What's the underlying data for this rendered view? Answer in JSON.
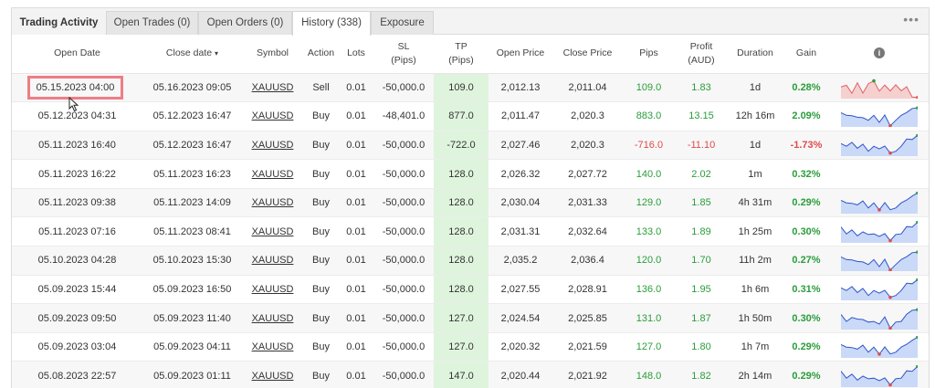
{
  "tabs": [
    {
      "label": "Trading Activity",
      "active": false
    },
    {
      "label": "Open Trades (0)",
      "active": false
    },
    {
      "label": "Open Orders (0)",
      "active": false
    },
    {
      "label": "History (338)",
      "active": true
    },
    {
      "label": "Exposure",
      "active": false
    }
  ],
  "menu_icon": "more-dots-icon",
  "columns": {
    "open_date": "Open Date",
    "close_date": "Close date",
    "close_date_sort": "▾",
    "symbol": "Symbol",
    "action": "Action",
    "lots": "Lots",
    "sl_1": "SL",
    "sl_2": "(Pips)",
    "tp_1": "TP",
    "tp_2": "(Pips)",
    "open_price": "Open Price",
    "close_price": "Close Price",
    "pips": "Pips",
    "profit_1": "Profit",
    "profit_2": "(AUD)",
    "duration": "Duration",
    "gain": "Gain",
    "info": "i"
  },
  "colors": {
    "positive": "#2a9d3a",
    "negative": "#e04b4b",
    "tp_highlight": "#dff4dd",
    "spark_fill": "#c9d9f7",
    "spark_line": "#2f55c9",
    "spark_fill_loss": "#f6cfcf",
    "spark_line_loss": "#e06060"
  },
  "rows": [
    {
      "open": "05.15.2023 04:00",
      "close": "05.16.2023 09:05",
      "symbol": "XAUUSD",
      "action": "Sell",
      "lots": "0.01",
      "sl": "-50,000.0",
      "tp": "109.0",
      "open_price": "2,012.13",
      "close_price": "2,011.04",
      "pips": "109.0",
      "profit": "1.83",
      "duration": "1d",
      "gain": "0.28%",
      "result": "pos",
      "spark": "loss",
      "highlight": true
    },
    {
      "open": "05.12.2023 04:31",
      "close": "05.12.2023 16:47",
      "symbol": "XAUUSD",
      "action": "Buy",
      "lots": "0.01",
      "sl": "-48,401.0",
      "tp": "877.0",
      "open_price": "2,011.47",
      "close_price": "2,020.3",
      "pips": "883.0",
      "profit": "13.15",
      "duration": "12h 16m",
      "gain": "2.09%",
      "result": "pos",
      "spark": "win"
    },
    {
      "open": "05.11.2023 16:40",
      "close": "05.12.2023 16:47",
      "symbol": "XAUUSD",
      "action": "Buy",
      "lots": "0.01",
      "sl": "-50,000.0",
      "tp": "-722.0",
      "open_price": "2,027.46",
      "close_price": "2,020.3",
      "pips": "-716.0",
      "profit": "-11.10",
      "duration": "1d",
      "gain": "-1.73%",
      "result": "neg",
      "spark": "win"
    },
    {
      "open": "05.11.2023 16:22",
      "close": "05.11.2023 16:23",
      "symbol": "XAUUSD",
      "action": "Buy",
      "lots": "0.01",
      "sl": "-50,000.0",
      "tp": "128.0",
      "open_price": "2,026.32",
      "close_price": "2,027.72",
      "pips": "140.0",
      "profit": "2.02",
      "duration": "1m",
      "gain": "0.32%",
      "result": "pos",
      "spark": "none"
    },
    {
      "open": "05.11.2023 09:38",
      "close": "05.11.2023 14:09",
      "symbol": "XAUUSD",
      "action": "Buy",
      "lots": "0.01",
      "sl": "-50,000.0",
      "tp": "128.0",
      "open_price": "2,030.04",
      "close_price": "2,031.33",
      "pips": "129.0",
      "profit": "1.85",
      "duration": "4h 31m",
      "gain": "0.29%",
      "result": "pos",
      "spark": "win"
    },
    {
      "open": "05.11.2023 07:16",
      "close": "05.11.2023 08:41",
      "symbol": "XAUUSD",
      "action": "Buy",
      "lots": "0.01",
      "sl": "-50,000.0",
      "tp": "128.0",
      "open_price": "2,031.31",
      "close_price": "2,032.64",
      "pips": "133.0",
      "profit": "1.89",
      "duration": "1h 25m",
      "gain": "0.30%",
      "result": "pos",
      "spark": "win"
    },
    {
      "open": "05.10.2023 04:28",
      "close": "05.10.2023 15:30",
      "symbol": "XAUUSD",
      "action": "Buy",
      "lots": "0.01",
      "sl": "-50,000.0",
      "tp": "128.0",
      "open_price": "2,035.2",
      "close_price": "2,036.4",
      "pips": "120.0",
      "profit": "1.70",
      "duration": "11h 2m",
      "gain": "0.27%",
      "result": "pos",
      "spark": "win"
    },
    {
      "open": "05.09.2023 15:44",
      "close": "05.09.2023 16:50",
      "symbol": "XAUUSD",
      "action": "Buy",
      "lots": "0.01",
      "sl": "-50,000.0",
      "tp": "128.0",
      "open_price": "2,027.55",
      "close_price": "2,028.91",
      "pips": "136.0",
      "profit": "1.95",
      "duration": "1h 6m",
      "gain": "0.31%",
      "result": "pos",
      "spark": "win"
    },
    {
      "open": "05.09.2023 09:50",
      "close": "05.09.2023 11:40",
      "symbol": "XAUUSD",
      "action": "Buy",
      "lots": "0.01",
      "sl": "-50,000.0",
      "tp": "127.0",
      "open_price": "2,024.54",
      "close_price": "2,025.85",
      "pips": "131.0",
      "profit": "1.87",
      "duration": "1h 50m",
      "gain": "0.30%",
      "result": "pos",
      "spark": "win"
    },
    {
      "open": "05.09.2023 03:04",
      "close": "05.09.2023 04:11",
      "symbol": "XAUUSD",
      "action": "Buy",
      "lots": "0.01",
      "sl": "-50,000.0",
      "tp": "127.0",
      "open_price": "2,020.32",
      "close_price": "2,021.59",
      "pips": "127.0",
      "profit": "1.80",
      "duration": "1h 7m",
      "gain": "0.29%",
      "result": "pos",
      "spark": "win"
    },
    {
      "open": "05.08.2023 22:57",
      "close": "05.09.2023 01:11",
      "symbol": "XAUUSD",
      "action": "Buy",
      "lots": "0.01",
      "sl": "-50,000.0",
      "tp": "147.0",
      "open_price": "2,020.44",
      "close_price": "2,021.92",
      "pips": "148.0",
      "profit": "1.82",
      "duration": "2h 14m",
      "gain": "0.29%",
      "result": "pos",
      "spark": "win"
    }
  ]
}
